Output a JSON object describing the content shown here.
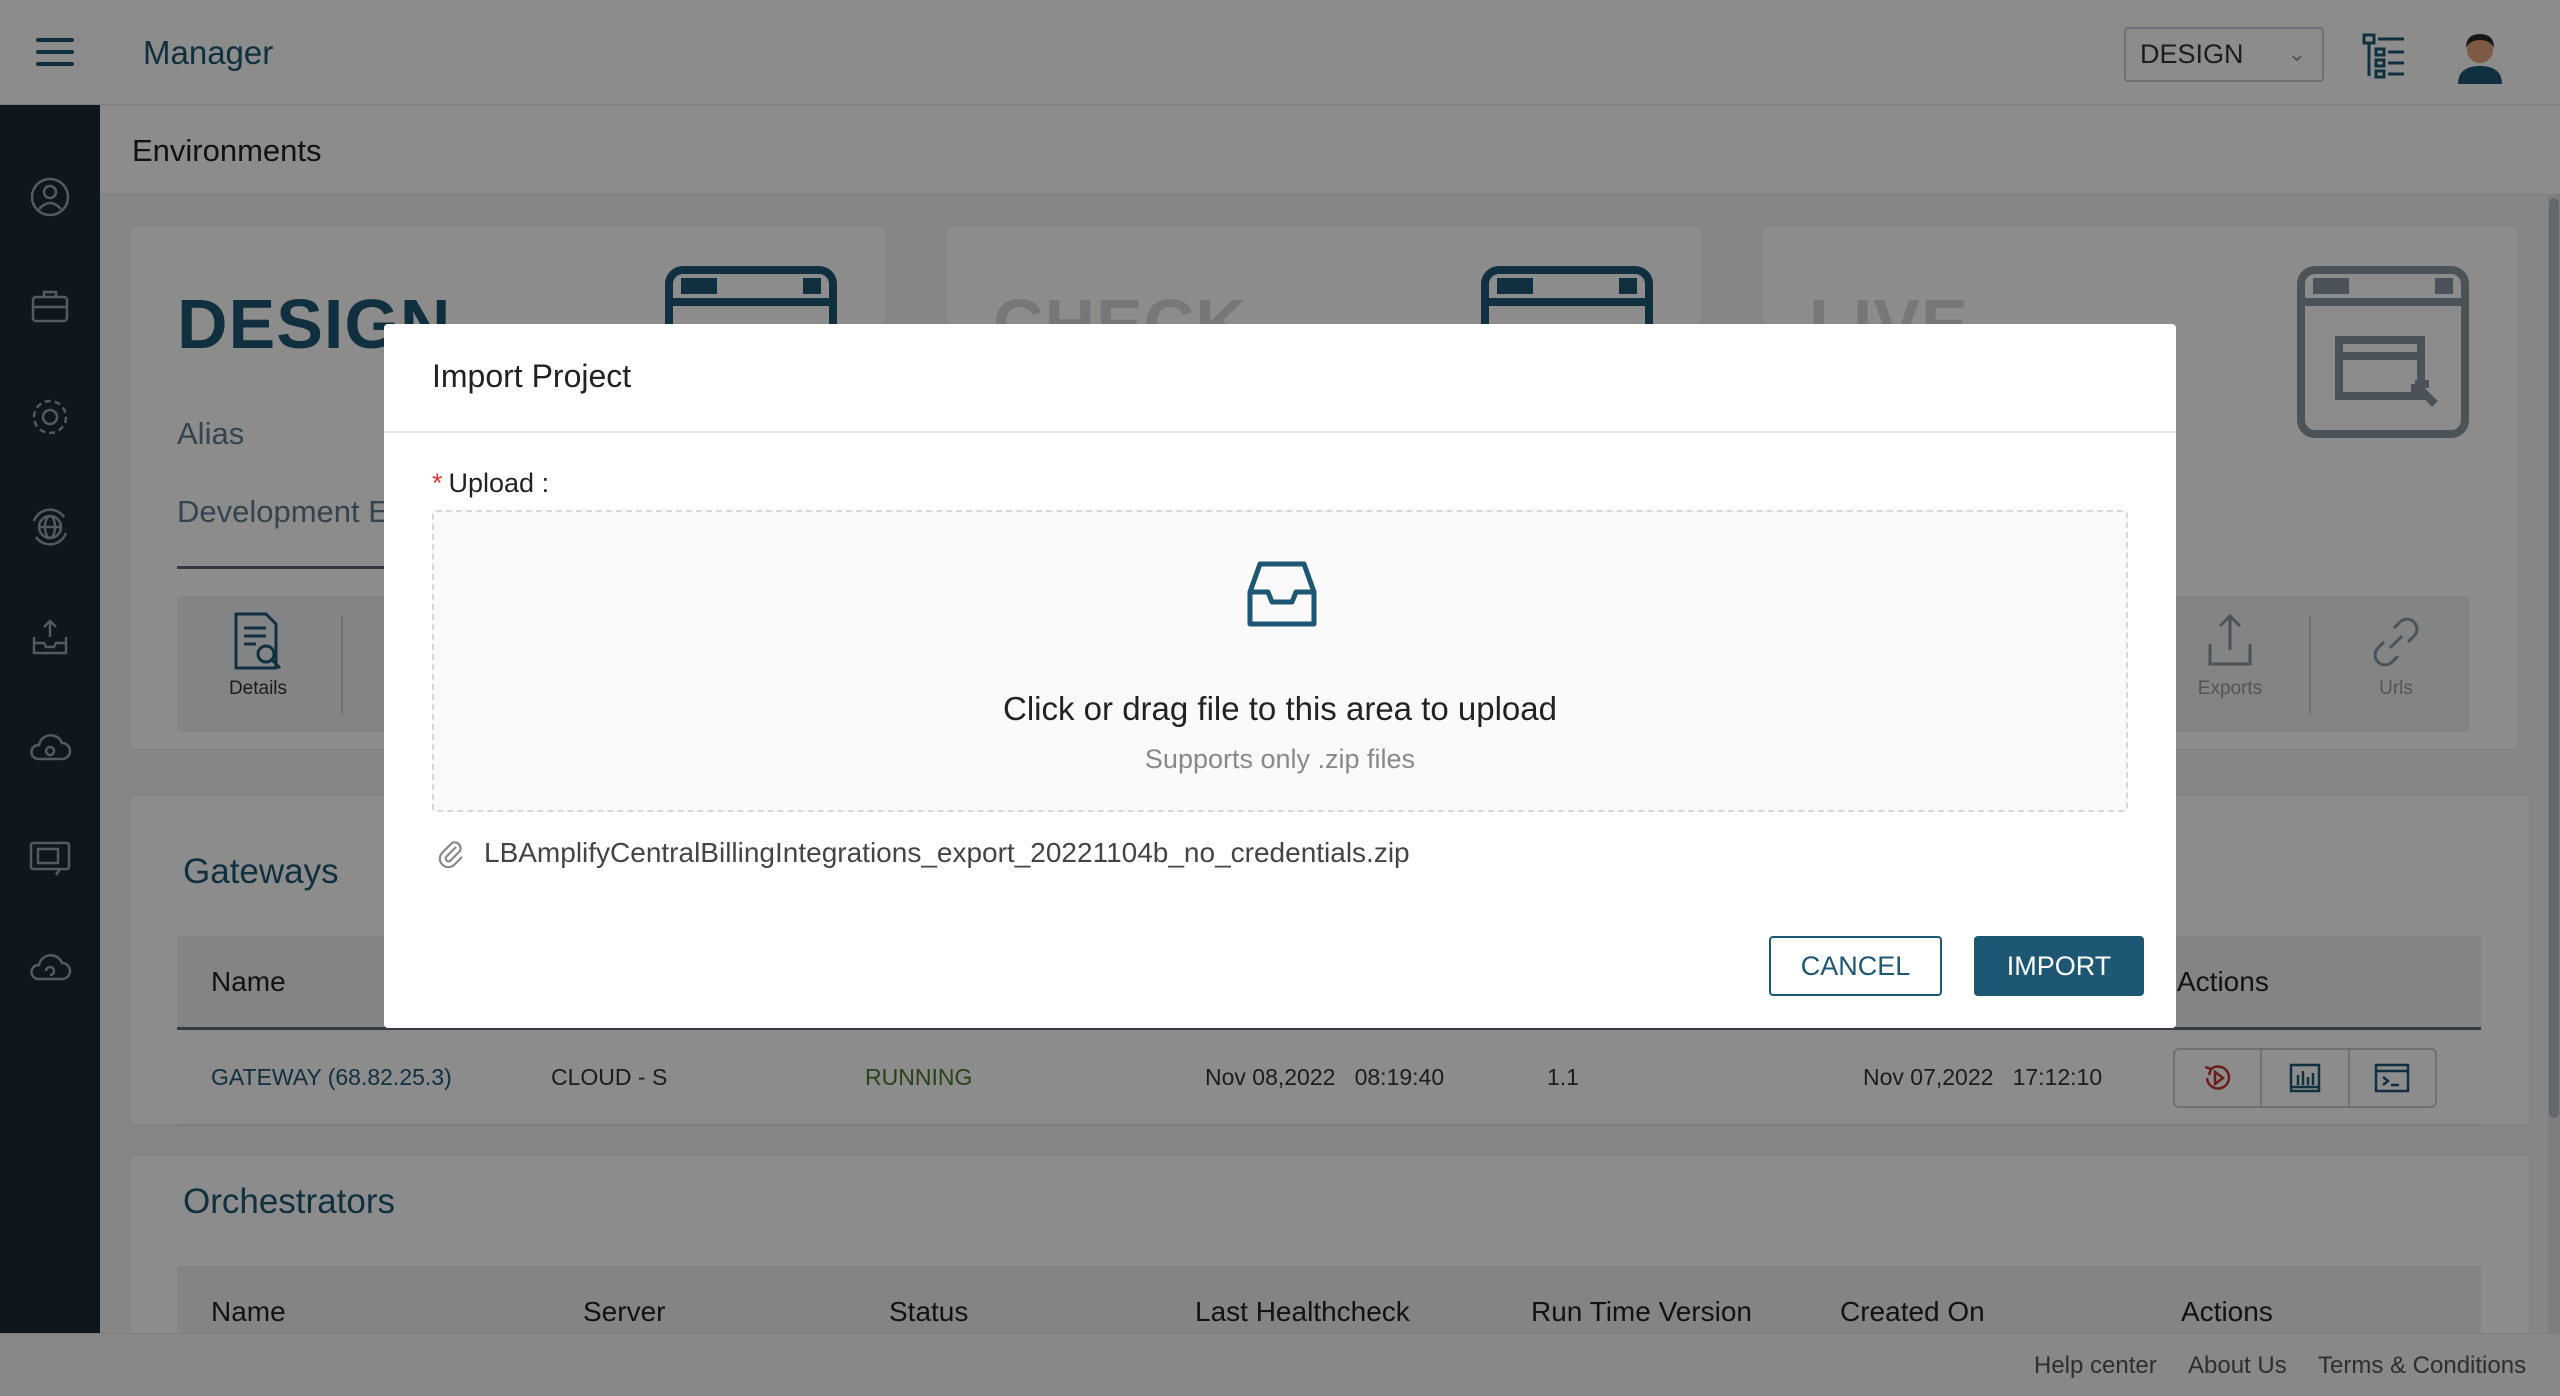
{
  "header": {
    "app_title": "Manager",
    "environment_select": "DESIGN"
  },
  "breadcrumb": {
    "title": "Environments"
  },
  "environments": [
    {
      "name": "DESIGN",
      "alias_label": "Alias",
      "description": "Development E"
    },
    {
      "name": "CHECK"
    },
    {
      "name": "LIVE"
    }
  ],
  "env_tools": {
    "details": "Details",
    "exports": "Exports",
    "urls": "Urls"
  },
  "gateways": {
    "title": "Gateways",
    "columns": {
      "name": "Name",
      "actions": "Actions"
    },
    "rows": [
      {
        "name": "GATEWAY (68.82.25.3)",
        "server": "CLOUD - S",
        "status": "RUNNING",
        "last_healthcheck": "Nov 08,2022   08:19:40",
        "runtime": "1.1",
        "created_on": "Nov 07,2022   17:12:10"
      }
    ]
  },
  "orchestrators": {
    "title": "Orchestrators",
    "columns": [
      "Name",
      "Server",
      "Status",
      "Last Healthcheck",
      "Run Time Version",
      "Created On",
      "Actions"
    ]
  },
  "footer": {
    "help": "Help center",
    "about": "About Us",
    "terms": "Terms & Conditions"
  },
  "modal": {
    "title": "Import Project",
    "upload_label": "Upload",
    "required_mark": "*",
    "dropzone_text": "Click or drag file to this area to upload",
    "dropzone_hint": "Supports only .zip files",
    "file_name": "LBAmplifyCentralBillingIntegrations_export_20221104b_no_credentials.zip",
    "cancel_label": "CANCEL",
    "import_label": "IMPORT"
  },
  "icons": {
    "menu": "hamburger-icon",
    "tree": "tree-view-icon",
    "avatar": "user-avatar",
    "upload": "inbox-icon",
    "attachment": "paperclip-icon"
  },
  "colors": {
    "brand": "#1e5774",
    "sidebar": "#1a2b36",
    "required": "#e0332c",
    "running": "#4a7a2c"
  }
}
